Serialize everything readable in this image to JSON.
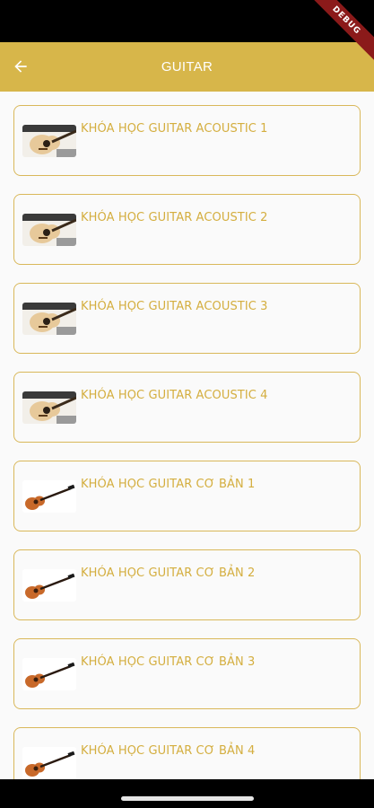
{
  "debug_banner": "DEBUG",
  "app_bar": {
    "title": "GUITAR",
    "back_icon": "arrow-left-icon"
  },
  "colors": {
    "accent": "#d7b64a",
    "title_text": "#d4ae3f",
    "card_border": "#d9b85a"
  },
  "courses": [
    {
      "title": "KHÓA HỌC GUITAR ACOUSTIC 1",
      "thumbnail": "acoustic-guitar-photo"
    },
    {
      "title": "KHÓA HỌC GUITAR ACOUSTIC 2",
      "thumbnail": "acoustic-guitar-photo"
    },
    {
      "title": "KHÓA HỌC GUITAR ACOUSTIC 3",
      "thumbnail": "acoustic-guitar-photo"
    },
    {
      "title": "KHÓA HỌC GUITAR ACOUSTIC 4",
      "thumbnail": "acoustic-guitar-photo"
    },
    {
      "title": "KHÓA HỌC GUITAR CƠ BẢN 1",
      "thumbnail": "classical-guitar-illustration"
    },
    {
      "title": "KHÓA HỌC GUITAR CƠ BẢN 2",
      "thumbnail": "classical-guitar-illustration"
    },
    {
      "title": "KHÓA HỌC GUITAR CƠ BẢN 3",
      "thumbnail": "classical-guitar-illustration"
    },
    {
      "title": "KHÓA HỌC GUITAR CƠ BẢN 4",
      "thumbnail": "classical-guitar-illustration"
    }
  ]
}
